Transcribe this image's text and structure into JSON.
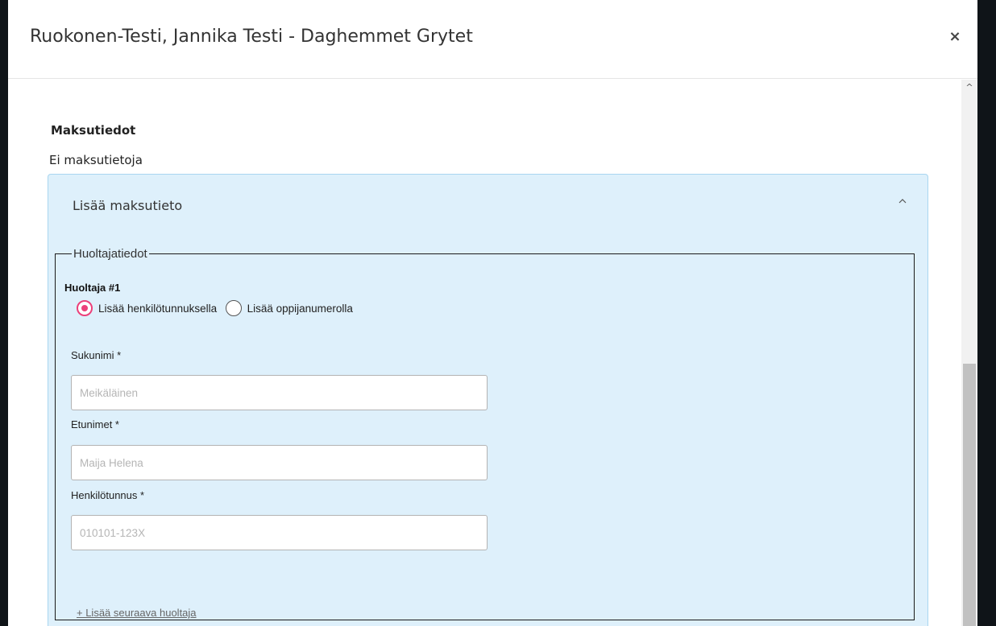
{
  "modal": {
    "title": "Ruokonen-Testi, Jannika Testi - Daghemmet Grytet",
    "close_label": "×"
  },
  "scrollbar": {
    "up_arrow": "^"
  },
  "payment": {
    "section_title": "Maksutiedot",
    "empty_text": "Ei maksutietoja"
  },
  "add_panel": {
    "title": "Lisää maksutieto",
    "expanded": true,
    "chevron_icon": "chevron-up-icon"
  },
  "guardians": {
    "legend": "Huoltajatiedot",
    "guardian_1": {
      "title": "Huoltaja #1",
      "radio": [
        {
          "label": "Lisää henkilötunnuksella",
          "checked": true
        },
        {
          "label": "Lisää oppijanumerolla",
          "checked": false
        }
      ],
      "fields": {
        "lastname": {
          "label": "Sukunimi *",
          "placeholder": "Meikäläinen",
          "value": ""
        },
        "firstnames": {
          "label": "Etunimet *",
          "placeholder": "Maija Helena",
          "value": ""
        },
        "ssn": {
          "label": "Henkilötunnus *",
          "placeholder": "010101-123X",
          "value": ""
        }
      }
    },
    "add_next_label": "+ Lisää seuraava huoltaja"
  },
  "colors": {
    "accent_pink": "#ec407a",
    "panel_bg": "#def0fb",
    "panel_border": "#a9d6f0"
  }
}
